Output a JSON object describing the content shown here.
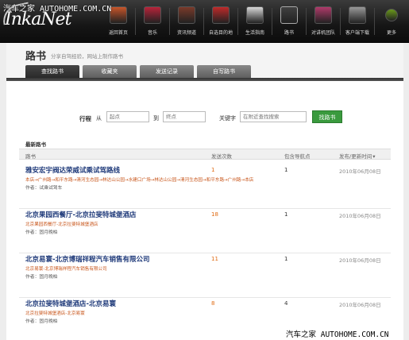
{
  "watermark": {
    "top": "汽车之家 AUTOHOME.COM.CN",
    "bottom": "汽车之家 AUTOHOME.COM.CN"
  },
  "logo": "InkaNet",
  "nav": [
    {
      "label": "返回首页",
      "icon": "home-icon",
      "color": "#c8552a"
    },
    {
      "label": "音乐",
      "icon": "music-icon",
      "color": "#b8233a"
    },
    {
      "label": "资讯频道",
      "icon": "news-icon",
      "color": "#7a3a2a"
    },
    {
      "label": "自选目的地",
      "icon": "destination-icon",
      "color": "#c02a2a"
    },
    {
      "label": "生活指南",
      "icon": "guide-icon",
      "color": "#d8d8d8"
    },
    {
      "label": "路书",
      "icon": "roadbook-icon",
      "color": "#404040"
    },
    {
      "label": "对讲机团队",
      "icon": "walkie-icon",
      "color": "#b03a6a"
    },
    {
      "label": "客户端下载",
      "icon": "download-icon",
      "color": "#999999"
    },
    {
      "label": "更多",
      "icon": "more-icon",
      "color": "#6a9a1a"
    }
  ],
  "page": {
    "title": "路书",
    "subtitle": "分享自驾经验，网站上制作路书",
    "tabs": [
      "查找路书",
      "收藏夹",
      "发送记录",
      "自写路书"
    ]
  },
  "search": {
    "route_label": "行程",
    "from_label": "从",
    "from_placeholder": "起点",
    "to_label": "到",
    "to_placeholder": "终点",
    "keyword_label": "关键字",
    "keyword_placeholder": "在附近查找搜索",
    "button": "找路书"
  },
  "table": {
    "section_title": "最新路书",
    "headers": [
      "路书",
      "发送次数",
      "包含导航点",
      "发布/更新时间"
    ],
    "rows": [
      {
        "title": "雅安宏宇阀达荣威试乘试驾路线",
        "path": "本店→广州路→和平东路→清河生态园→林达山公园→水建口广场→林达山公园→清河生态园→和平东路→广州路→本店",
        "author": "作者：试乘试驾车",
        "count": "1",
        "nodes": "1",
        "date": "2010年06月08日"
      },
      {
        "title": "北京果园西餐厅-北京拉斐特城堡酒店",
        "path": "北京果园西餐厅-北京拉斐特城堡酒店",
        "author": "作者：固月晚柏",
        "count": "18",
        "nodes": "1",
        "date": "2010年06月08日"
      },
      {
        "title": "北京易寰-北京博瑞祥程汽车销售有限公司",
        "path": "北京易寰-北京博瑞祥程汽车销售有限公司",
        "author": "作者：固月晚柏",
        "count": "11",
        "nodes": "1",
        "date": "2010年06月08日"
      },
      {
        "title": "北京拉斐特城堡酒店-北京易寰",
        "path": "北京拉斐特城堡酒店-北京易寰",
        "author": "作者：固月晚柏",
        "count": "8",
        "nodes": "4",
        "date": "2010年06月08日"
      }
    ]
  }
}
